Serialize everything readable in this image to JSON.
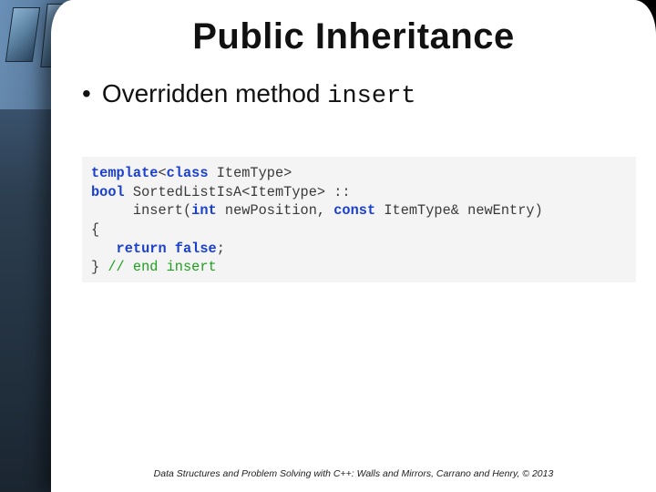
{
  "title": "Public Inheritance",
  "bullet": {
    "marker": "•",
    "text_before": "Overridden method ",
    "code": "insert"
  },
  "code": {
    "l1_kw1": "template",
    "l1_punc1": "<",
    "l1_kw2": "class",
    "l1_sp": " ",
    "l1_type": "ItemType",
    "l1_punc2": ">",
    "l2_kw1": "bool",
    "l2_sp": " ",
    "l2_cls": "SortedListIsA",
    "l2_punc1": "<",
    "l2_t": "ItemType",
    "l2_punc2": "> ::",
    "l3_pad": "     ",
    "l3_fn": "insert",
    "l3_open": "(",
    "l3_kw1": "int",
    "l3_sp1": " ",
    "l3_p1": "newPosition",
    "l3_comma": ", ",
    "l3_kw2": "const",
    "l3_sp2": " ",
    "l3_t": "ItemType",
    "l3_amp": "& ",
    "l3_p2": "newEntry",
    "l3_close": ")",
    "l4": "{",
    "l5_pad": "   ",
    "l5_kw": "return false",
    "l5_semi": ";",
    "l6_close": "} ",
    "l6_cmt": "// end insert"
  },
  "footer": "Data Structures and Problem Solving with C++: Walls and Mirrors, Carrano and Henry, ©  2013"
}
